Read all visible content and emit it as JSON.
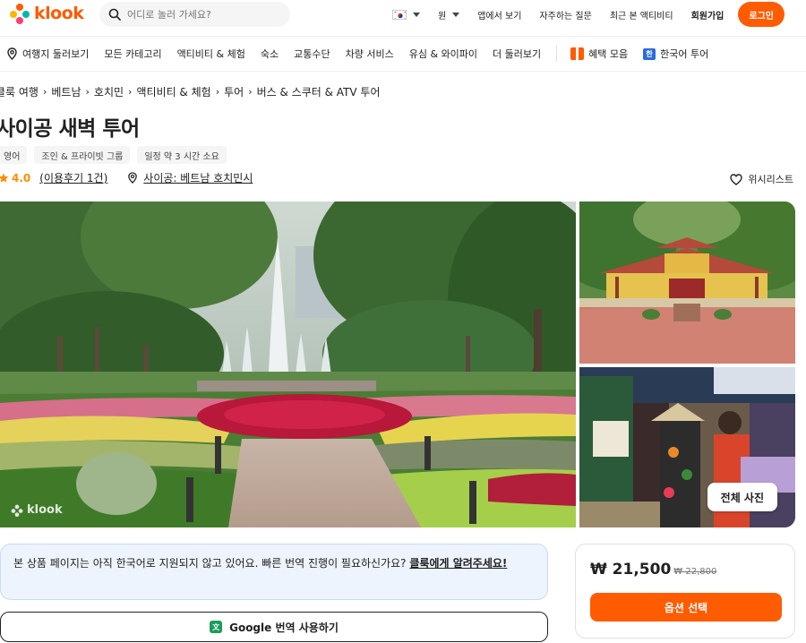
{
  "header": {
    "logo_text": "klook",
    "search_placeholder": "어디로 놀러 가세요?",
    "currency": "원",
    "items": [
      "앱에서 보기",
      "자주하는 질문",
      "최근 본 액티비티"
    ],
    "signup": "회원가입",
    "login": "로그인"
  },
  "nav": {
    "explore": "여행지 둘러보기",
    "categories": [
      "모든 카테고리",
      "액티비티 & 체험",
      "숙소",
      "교통수단",
      "차량 서비스",
      "유심 & 와이파이",
      "더 둘러보기"
    ],
    "deals": "혜택 모음",
    "korean_tour": "한국어 투어"
  },
  "breadcrumb": [
    "클룩 여행",
    "베트남",
    "호치민",
    "액티비티 & 체험",
    "투어",
    "버스 & 스쿠터 & ATV 투어"
  ],
  "product": {
    "title": "사이공 새벽 투어",
    "tags": [
      "영어",
      "조인 & 프라이빗 그룹",
      "일정 약 3 시간 소요"
    ],
    "rating": "4.0",
    "reviews": "(이용후기 1건)",
    "location": "사이공: 베트남 호치민시",
    "wishlist": "위시리스트",
    "all_photos": "전체 사진",
    "watermark": "klook"
  },
  "notice": {
    "text": "본 상품 페이지는 아직 한국어로 지원되지 않고 있어요. 빠른 번역 진행이 필요하신가요? ",
    "link": "클룩에게 알려주세요!"
  },
  "google_translate": {
    "brand": "Google",
    "label": " 번역 사용하기"
  },
  "pricing": {
    "price": "₩ 21,500",
    "original": "₩ 22,800",
    "select_option": "옵션 선택"
  },
  "colors": {
    "accent": "#ff5b00",
    "rating": "#ff8c00",
    "notice_bg": "#eef4fd"
  }
}
